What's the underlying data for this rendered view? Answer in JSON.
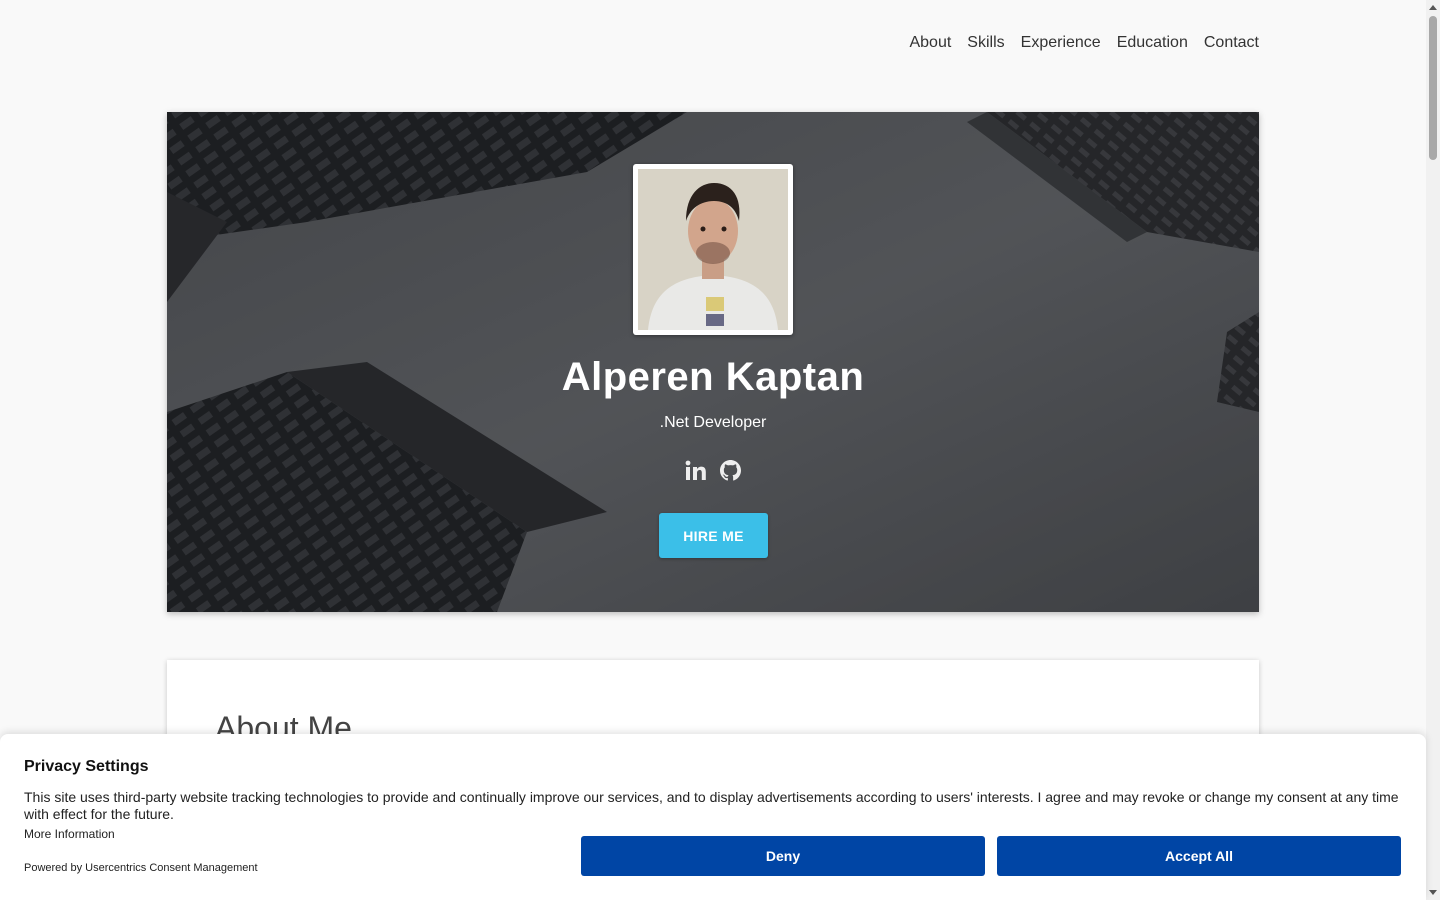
{
  "nav": {
    "items": [
      "About",
      "Skills",
      "Experience",
      "Education",
      "Contact"
    ]
  },
  "hero": {
    "name": "Alperen Kaptan",
    "role": ".Net Developer",
    "socials": [
      "linkedin-icon",
      "github-icon"
    ],
    "cta_label": "HIRE ME",
    "cta_color": "#3bbfe8"
  },
  "about": {
    "heading": "About Me"
  },
  "consent": {
    "title": "Privacy Settings",
    "description": "This site uses third-party website tracking technologies to provide and continually improve our services, and to display advertisements according to users' interests. I agree and may revoke or change my consent at any time with effect for the future.",
    "more_label": "More Information",
    "powered_by": "Powered by Usercentrics Consent Management",
    "deny_label": "Deny",
    "accept_label": "Accept All",
    "button_color": "#0045a5"
  }
}
